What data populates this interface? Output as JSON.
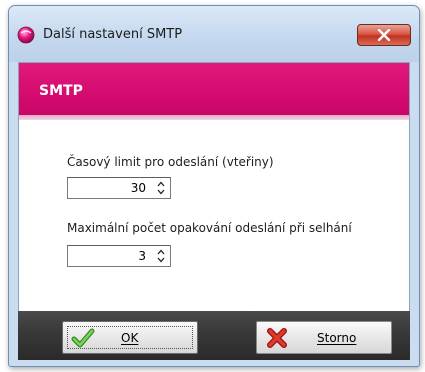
{
  "window": {
    "title": "Další nastavení SMTP",
    "icon": "pink-orb-icon",
    "close_icon": "close-icon"
  },
  "header": {
    "title": "SMTP",
    "band_color": "#d40a6e"
  },
  "fields": [
    {
      "label": "Časový limit pro odeslání (vteřiny)",
      "value": "30"
    },
    {
      "label": "Maximální počet opakování odeslání při selhání",
      "value": "3"
    }
  ],
  "footer": {
    "ok_label": "OK",
    "ok_icon": "green-checkmark-icon",
    "cancel_label": "Storno",
    "cancel_icon": "red-x-icon"
  }
}
